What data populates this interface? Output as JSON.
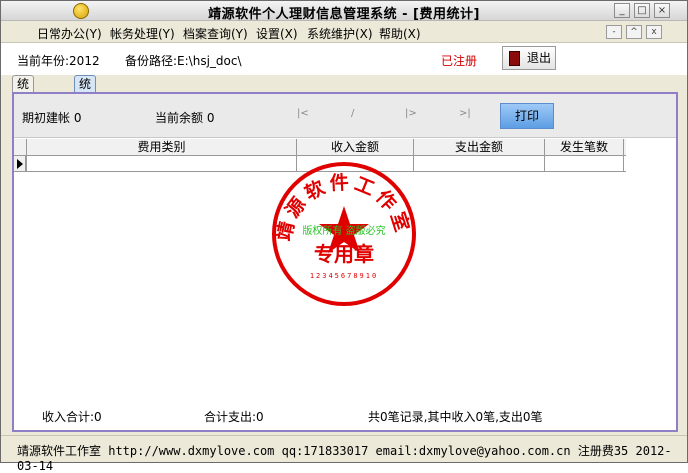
{
  "window": {
    "title": "靖源软件个人理财信息管理系统 - [费用统计]",
    "controls": [
      "_",
      "□",
      "×"
    ],
    "mdi_controls": [
      "-",
      "^",
      "x"
    ]
  },
  "menu": [
    "日常办公(Y)",
    "帐务处理(Y)",
    "档案查询(Y)",
    "设置(X)",
    "系统维护(X)",
    "帮助(X)"
  ],
  "info": {
    "year_label": "当前年份:2012",
    "path_label": "备份路径:E:\\hsj_doc\\",
    "registered": "已注册",
    "exit_label": "退出"
  },
  "tabs": [
    {
      "label": "统计条件",
      "active": false
    },
    {
      "label": "统计结果",
      "active": true
    }
  ],
  "panel": {
    "opening_label": "期初建帐 0",
    "balance_label": "当前余额 0",
    "print_label": "打印"
  },
  "grid": {
    "columns": [
      "费用类别",
      "收入金额",
      "支出金额",
      "发生笔数"
    ],
    "rows": [
      [
        "",
        "",
        "",
        ""
      ]
    ]
  },
  "stamp": {
    "outer_text": "靖源软件工作室",
    "watermark": "版权所有 盗版必究",
    "center": "专用章",
    "serial": "12345678910"
  },
  "sums": {
    "income_total": "收入合计:0",
    "expense_total": "合计支出:0",
    "records": "共0笔记录,其中收入0笔,支出0笔"
  },
  "status": "靖源软件工作室 http://www.dxmylove.com qq:171833017 email:dxmylove@yahoo.com.cn 注册费35 2012-03-14",
  "colors": {
    "registered": "#d40000",
    "stamp": "#e00000",
    "watermark": "#25c225",
    "panel_border": "#8e7fc7"
  }
}
